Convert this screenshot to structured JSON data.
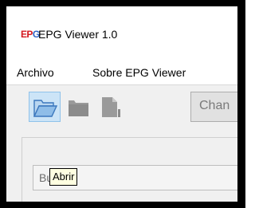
{
  "window": {
    "logo": {
      "e": "E",
      "p": "P",
      "g": "G"
    },
    "title": "EPG Viewer 1.0"
  },
  "menubar": {
    "items": [
      {
        "label": "Archivo"
      },
      {
        "label": "Sobre EPG Viewer"
      }
    ]
  },
  "toolbar": {
    "open_icon": "folder-open-icon",
    "save_icon": "save-disabled-icon",
    "export_icon": "export-disabled-icon",
    "change_label": "Chan"
  },
  "content": {
    "search_value": "Bu                ."
  },
  "tooltip": {
    "text": "Abrir"
  },
  "colors": {
    "logo_red": "#d4181f",
    "logo_blue": "#2d63c6",
    "hover_fill": "#cce4f7",
    "tooltip_bg": "#ffffe1"
  }
}
